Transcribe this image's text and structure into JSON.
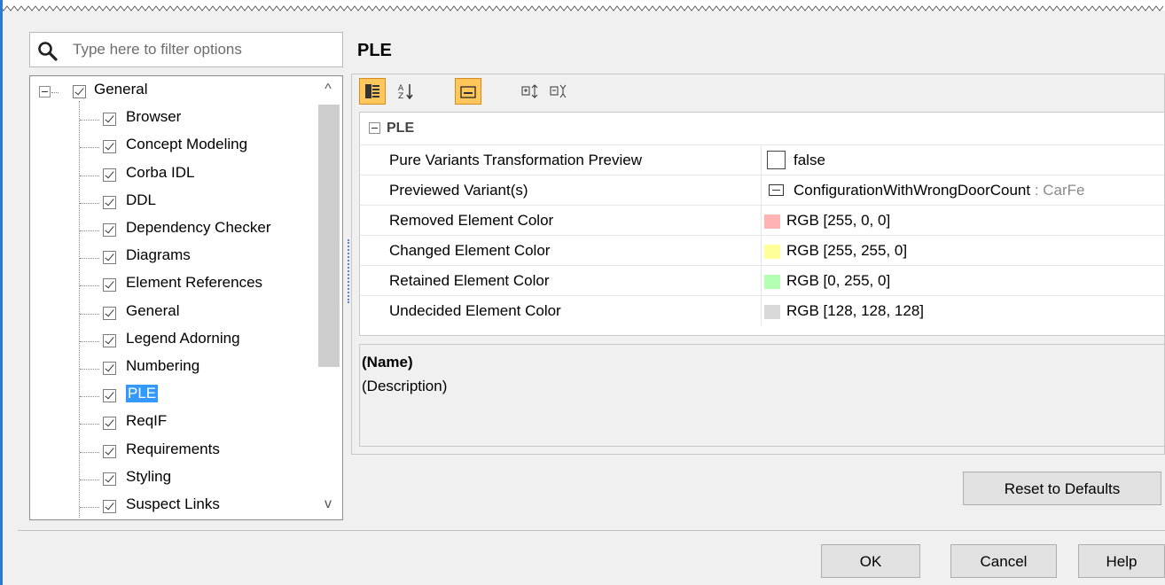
{
  "search": {
    "placeholder": "Type here to filter options"
  },
  "tree": {
    "items": [
      {
        "label": "General",
        "level": 0
      },
      {
        "label": "Browser",
        "level": 1
      },
      {
        "label": "Concept Modeling",
        "level": 1
      },
      {
        "label": "Corba IDL",
        "level": 1
      },
      {
        "label": "DDL",
        "level": 1
      },
      {
        "label": "Dependency Checker",
        "level": 1
      },
      {
        "label": "Diagrams",
        "level": 1
      },
      {
        "label": "Element References",
        "level": 1
      },
      {
        "label": "General",
        "level": 1
      },
      {
        "label": "Legend Adorning",
        "level": 1
      },
      {
        "label": "Numbering",
        "level": 1
      },
      {
        "label": "PLE",
        "level": 1,
        "selected": true
      },
      {
        "label": "ReqIF",
        "level": 1
      },
      {
        "label": "Requirements",
        "level": 1
      },
      {
        "label": "Styling",
        "level": 1
      },
      {
        "label": "Suspect Links",
        "level": 1
      }
    ],
    "scroll_up": "^",
    "scroll_down": "v"
  },
  "main": {
    "section_title": "PLE",
    "group_label": "PLE",
    "properties": [
      {
        "name": "Pure Variants Transformation Preview",
        "value": "false",
        "kind": "boolean"
      },
      {
        "name": "Previewed Variant(s)",
        "value": "ConfigurationWithWrongDoorCount",
        "type_suffix": " : CarFe",
        "kind": "variant"
      },
      {
        "name": "Removed Element Color",
        "value": "RGB [255, 0, 0]",
        "swatch": "#ffb3b3",
        "kind": "color"
      },
      {
        "name": "Changed Element Color",
        "value": "RGB [255, 255, 0]",
        "swatch": "#ffff99",
        "kind": "color"
      },
      {
        "name": "Retained Element Color",
        "value": "RGB [0, 255, 0]",
        "swatch": "#b3ffb3",
        "kind": "color"
      },
      {
        "name": "Undecided Element Color",
        "value": "RGB [128, 128, 128]",
        "swatch": "#d9d9d9",
        "kind": "color"
      }
    ],
    "description_name": "(Name)",
    "description_text": "(Description)"
  },
  "buttons": {
    "reset": "Reset to Defaults",
    "ok": "OK",
    "cancel": "Cancel",
    "help": "Help"
  },
  "colors": {
    "selection": "#3399ff",
    "active_toolbar": "#ffc65c",
    "window_accent": "#2b79d6"
  }
}
